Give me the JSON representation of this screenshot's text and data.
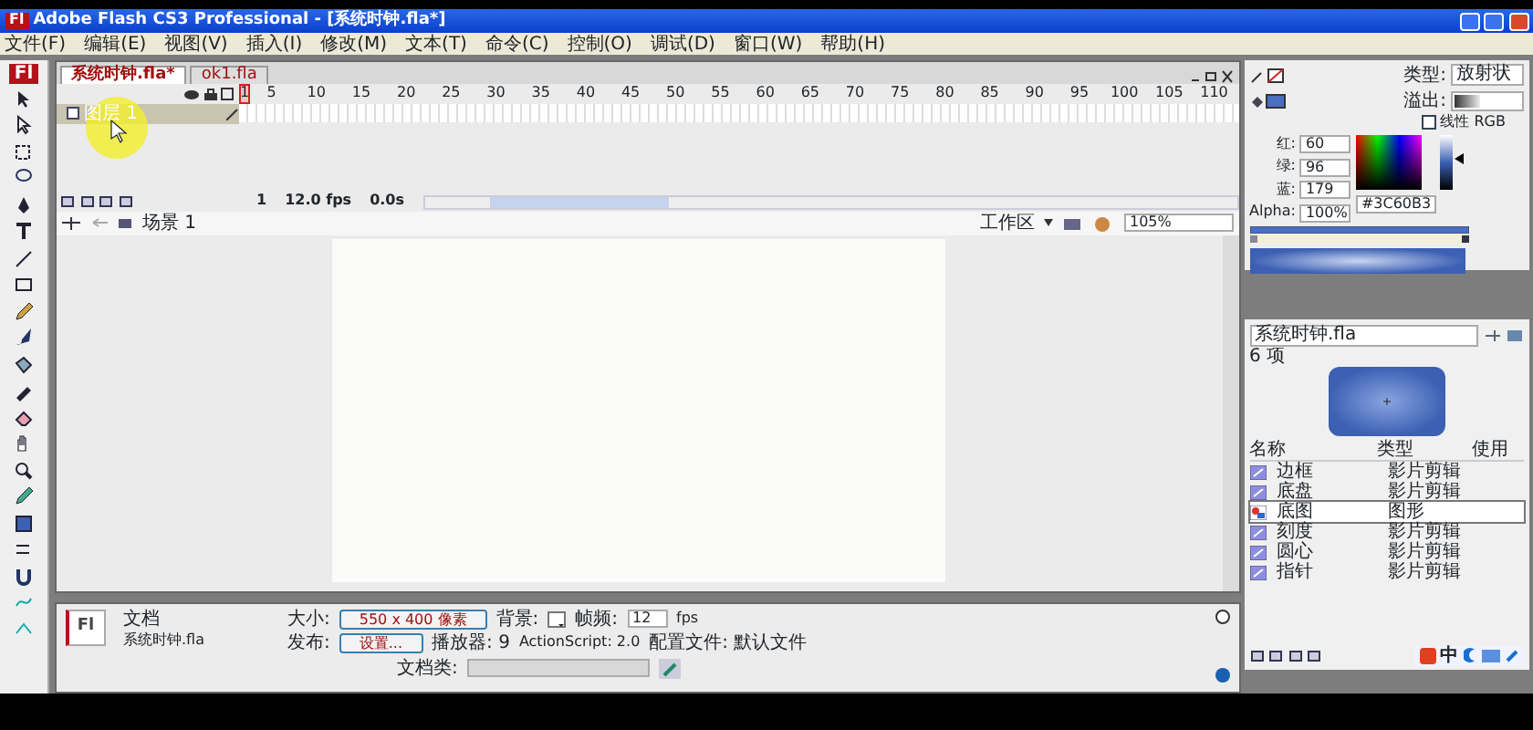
{
  "window": {
    "app_icon": "Fl",
    "title": "Adobe Flash CS3 Professional - [系统时钟.fla*]"
  },
  "menu": [
    "文件(F)",
    "编辑(E)",
    "视图(V)",
    "插入(I)",
    "修改(M)",
    "文本(T)",
    "命令(C)",
    "控制(O)",
    "调试(D)",
    "窗口(W)",
    "帮助(H)"
  ],
  "toolbar": {
    "logo": "Fl"
  },
  "doc_tabs": [
    {
      "label": "系统时钟.fla*",
      "selected": true
    },
    {
      "label": "ok1.fla",
      "selected": false
    }
  ],
  "timeline": {
    "playhead": "1",
    "frames": [
      "5",
      "10",
      "15",
      "20",
      "25",
      "30",
      "35",
      "40",
      "45",
      "50",
      "55",
      "60",
      "65",
      "70",
      "75",
      "80",
      "85",
      "90",
      "95",
      "100",
      "105",
      "110"
    ],
    "layers": [
      {
        "name": "图层 1",
        "selected": true
      }
    ],
    "current_frame": "1",
    "frame_rate": "12.0 fps",
    "elapsed": "0.0s"
  },
  "scene_bar": {
    "scene": "场景 1",
    "workspace": "工作区",
    "zoom": "105%"
  },
  "color_panel": {
    "type_label": "类型:",
    "type_value": "放射状",
    "overflow_label": "溢出:",
    "linear_rgb": {
      "label": "线性 RGB",
      "checked": false
    },
    "channels": [
      {
        "label": "红:",
        "value": "60"
      },
      {
        "label": "绿:",
        "value": "96"
      },
      {
        "label": "蓝:",
        "value": "179"
      },
      {
        "label": "Alpha:",
        "value": "100%"
      }
    ],
    "hex": "#3C60B3",
    "brightness": {
      "level": 0.6
    }
  },
  "library": {
    "file": "系统时钟.fla",
    "count": "6 项",
    "columns": [
      "名称",
      "类型",
      "使用"
    ],
    "items": [
      {
        "name": "边框",
        "type": "影片剪辑",
        "kind": "movieclip",
        "selected": false
      },
      {
        "name": "底盘",
        "type": "影片剪辑",
        "kind": "movieclip",
        "selected": false
      },
      {
        "name": "底图",
        "type": "图形",
        "kind": "graphic",
        "selected": true
      },
      {
        "name": "刻度",
        "type": "影片剪辑",
        "kind": "movieclip",
        "selected": false
      },
      {
        "name": "圆心",
        "type": "影片剪辑",
        "kind": "movieclip",
        "selected": false
      },
      {
        "name": "指针",
        "type": "影片剪辑",
        "kind": "movieclip",
        "selected": false
      }
    ]
  },
  "properties": {
    "logo": "Fl",
    "kind": "文档",
    "file": "系统时钟.fla",
    "size_label": "大小:",
    "size": "550 x 400 像素",
    "publish_label": "发布:",
    "settings": "设置...",
    "background_label": "背景:",
    "fps_label": "帧频:",
    "fps": "12",
    "fps_unit": "fps",
    "player": "播放器: 9",
    "actionscript": "ActionScript: 2.0",
    "profile": "配置文件: 默认文件",
    "doc_class_label": "文档类:"
  },
  "ime": {
    "label": "中"
  }
}
